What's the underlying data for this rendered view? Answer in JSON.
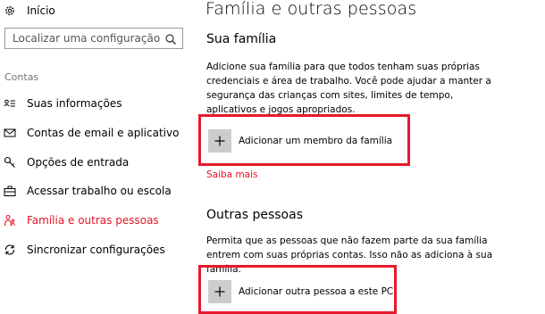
{
  "sidebar": {
    "home_label": "Início",
    "search": {
      "placeholder": "Localizar uma configuração"
    },
    "section_label": "Contas",
    "items": [
      {
        "label": "Suas informações",
        "icon": "person-card-icon"
      },
      {
        "label": "Contas de email e aplicativo",
        "icon": "mail-icon"
      },
      {
        "label": "Opções de entrada",
        "icon": "key-icon"
      },
      {
        "label": "Acessar trabalho ou escola",
        "icon": "briefcase-icon"
      },
      {
        "label": "Família e outras pessoas",
        "icon": "family-icon",
        "active": true
      },
      {
        "label": "Sincronizar configurações",
        "icon": "sync-icon"
      }
    ]
  },
  "main": {
    "title": "Família e outras pessoas",
    "family": {
      "heading": "Sua família",
      "description": "Adicione sua família para que todos tenham suas próprias credenciais e área de trabalho. Você pode ajudar a manter a segurança das crianças com sites, limites de tempo, aplicativos e jogos apropriados.",
      "add_label": "Adicionar um membro da família",
      "link": "Saiba mais"
    },
    "others": {
      "heading": "Outras pessoas",
      "description": "Permita que as pessoas que não fazem parte da sua família entrem com suas próprias contas. Isso não as adiciona à sua família.",
      "add_label": "Adicionar outra pessoa a este PC"
    }
  },
  "colors": {
    "accent": "#e81123",
    "highlight": "#e8192c",
    "plus_tile": "#cccccc"
  }
}
